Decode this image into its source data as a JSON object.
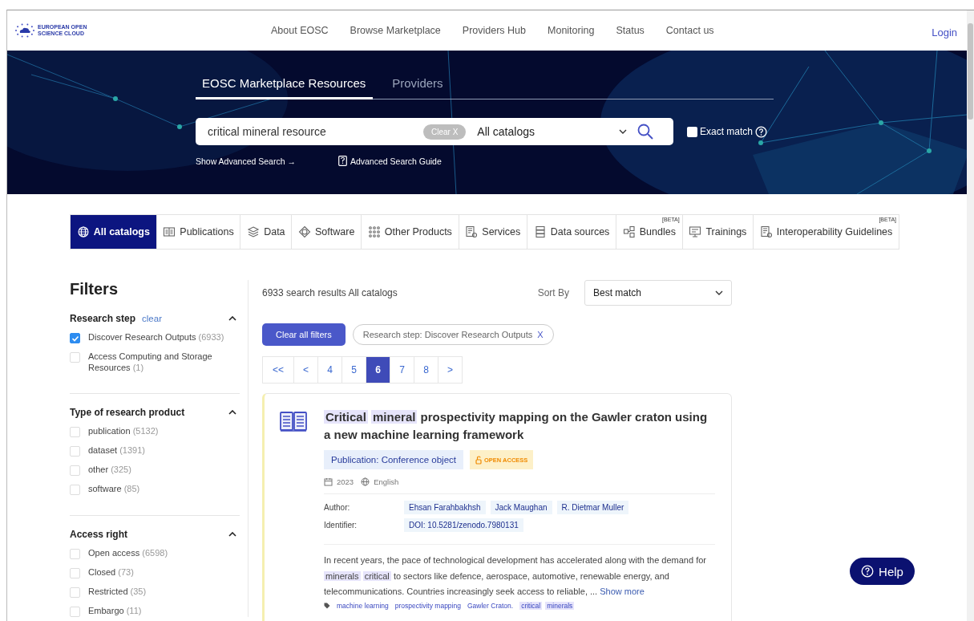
{
  "header": {
    "logo_lines": [
      "EUROPEAN OPEN",
      "SCIENCE CLOUD"
    ],
    "nav": [
      "About EOSC",
      "Browse Marketplace",
      "Providers Hub",
      "Monitoring",
      "Status",
      "Contact us"
    ],
    "login": "Login"
  },
  "search": {
    "tabs": [
      {
        "label": "EOSC Marketplace Resources",
        "selected": true
      },
      {
        "label": "Providers",
        "selected": false
      }
    ],
    "query": "critical mineral resource",
    "clear": "Clear X",
    "catalog": "All catalogs",
    "exact_match": {
      "label": "Exact match",
      "checked": false
    },
    "advanced": "Show Advanced Search →",
    "guide": "Advanced Search Guide"
  },
  "catalog_tabs": [
    {
      "label": "All catalogs",
      "selected": true
    },
    {
      "label": "Publications",
      "selected": false
    },
    {
      "label": "Data",
      "selected": false
    },
    {
      "label": "Software",
      "selected": false
    },
    {
      "label": "Other Products",
      "selected": false
    },
    {
      "label": "Services",
      "selected": false
    },
    {
      "label": "Data sources",
      "selected": false
    },
    {
      "label": "Bundles",
      "selected": false,
      "badge": "[BETA]"
    },
    {
      "label": "Trainings",
      "selected": false
    },
    {
      "label": "Interoperability Guidelines",
      "selected": false,
      "badge": "[BETA]"
    }
  ],
  "filters": {
    "title": "Filters",
    "groups": [
      {
        "title": "Research step",
        "clear": "clear",
        "expanded": true,
        "options": [
          {
            "label": "Discover Research Outputs",
            "count": "(6933)",
            "checked": true
          },
          {
            "label": "Access Computing and Storage Resources",
            "count": "(1)",
            "checked": false
          }
        ]
      },
      {
        "title": "Type of research product",
        "expanded": true,
        "options": [
          {
            "label": "publication",
            "count": "(5132)",
            "checked": false
          },
          {
            "label": "dataset",
            "count": "(1391)",
            "checked": false
          },
          {
            "label": "other",
            "count": "(325)",
            "checked": false
          },
          {
            "label": "software",
            "count": "(85)",
            "checked": false
          }
        ]
      },
      {
        "title": "Access right",
        "expanded": true,
        "options": [
          {
            "label": "Open access",
            "count": "(6598)",
            "checked": false
          },
          {
            "label": "Closed",
            "count": "(73)",
            "checked": false
          },
          {
            "label": "Restricted",
            "count": "(35)",
            "checked": false
          },
          {
            "label": "Embargo",
            "count": "(11)",
            "checked": false
          }
        ]
      }
    ]
  },
  "results": {
    "summary": "6933 search results All catalogs",
    "sort_label": "Sort By",
    "sort": "Best match",
    "clear_all": "Clear all filters",
    "chips": [
      {
        "label": "Research step: Discover Research Outputs",
        "remove": "X"
      }
    ],
    "pages": [
      {
        "label": "<<",
        "selected": false
      },
      {
        "label": "<",
        "selected": false
      },
      {
        "label": "4",
        "selected": false
      },
      {
        "label": "5",
        "selected": false
      },
      {
        "label": "6",
        "selected": true
      },
      {
        "label": "7",
        "selected": false
      },
      {
        "label": "8",
        "selected": false
      },
      {
        "label": ">",
        "selected": false
      }
    ],
    "items": [
      {
        "title": [
          {
            "text": "Critical",
            "highlight": true
          },
          {
            "text": "mineral",
            "highlight": true
          },
          {
            "text": "prospectivity mapping on the Gawler craton using a new machine learning framework",
            "highlight": false
          }
        ],
        "type": "Publication: Conference object",
        "access": "OPEN ACCESS",
        "year": "2023",
        "language": "English",
        "fields": [
          {
            "label": "Author:",
            "values": [
              "Ehsan Farahbakhsh",
              "Jack Maughan",
              "R. Dietmar Muller"
            ]
          },
          {
            "label": "Identifier:",
            "values": [
              "DOI: 10.5281/zenodo.7980131"
            ]
          }
        ],
        "description": [
          {
            "text": "In recent years, the pace of technological development has accelerated along with the demand for",
            "highlight": false
          },
          {
            "text": "minerals",
            "highlight": true
          },
          {
            "text": "critical",
            "highlight": true
          },
          {
            "text": "to sectors like defence, aerospace, automotive, renewable energy, and telecommunications. Countries increasingly seek access to reliable, ...",
            "highlight": false
          }
        ],
        "show_more": "Show more",
        "tags": [
          {
            "label": "machine learning",
            "highlight": false
          },
          {
            "label": "prospectivity mapping",
            "highlight": false
          },
          {
            "label": "Gawler Craton.",
            "highlight": false
          },
          {
            "label": "critical",
            "highlight": true
          },
          {
            "label": "minerals",
            "highlight": true
          }
        ]
      }
    ]
  },
  "help": "Help"
}
